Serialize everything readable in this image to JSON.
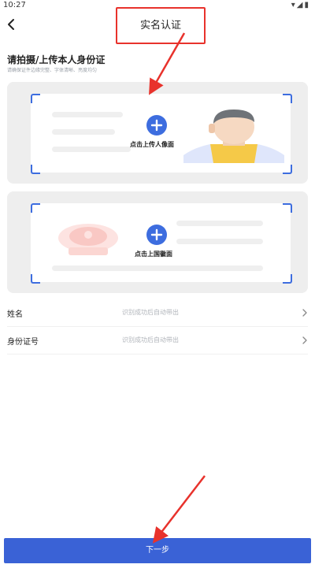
{
  "status_bar": {
    "time": "10:27",
    "icons": [
      "wifi-icon",
      "signal-icon",
      "battery-icon"
    ]
  },
  "header": {
    "back_icon": "back-arrow-icon",
    "title": "实名认证"
  },
  "instructions": {
    "title": "请拍摄/上传本人身份证",
    "hint": "请确保证件边缘完整、字体清晰、亮度均匀"
  },
  "id_front": {
    "label": "点击上传人像面",
    "plus_icon": "plus-icon"
  },
  "id_back": {
    "label": "点击上国徽面",
    "plus_icon": "plus-icon"
  },
  "form": {
    "rows": [
      {
        "label": "姓名",
        "placeholder": "识别成功后自动带出"
      },
      {
        "label": "身份证号",
        "placeholder": "识别成功后自动带出"
      }
    ]
  },
  "footer": {
    "next_label": "下一步"
  },
  "colors": {
    "accent": "#3a62d6",
    "annotation_red": "#e8322c",
    "card_bg": "#eeeeee"
  }
}
